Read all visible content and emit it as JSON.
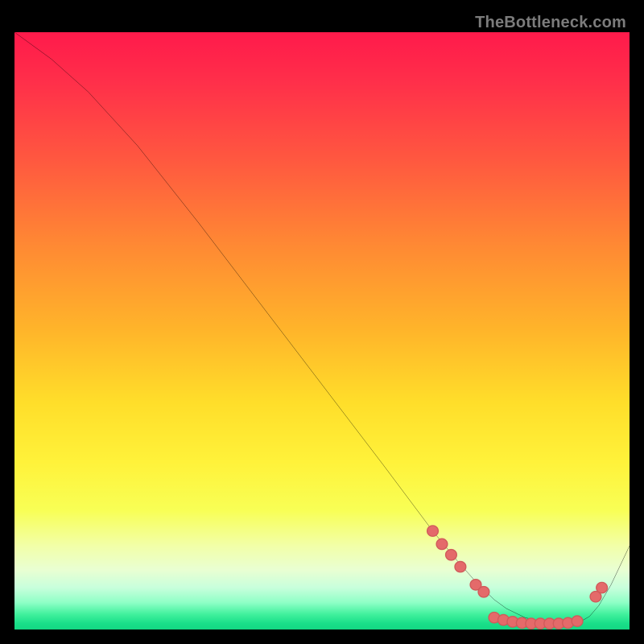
{
  "watermark": "TheBottleneck.com",
  "chart_data": {
    "type": "line",
    "title": "",
    "xlabel": "",
    "ylabel": "",
    "xlim": [
      0,
      100
    ],
    "ylim": [
      0,
      100
    ],
    "series": [
      {
        "name": "curve",
        "x": [
          0,
          6,
          12,
          20,
          30,
          40,
          50,
          60,
          68,
          72,
          75,
          78,
          80,
          83,
          86,
          88,
          90,
          92,
          93.5,
          95,
          97,
          100
        ],
        "y": [
          100,
          95.5,
          90,
          81,
          68,
          54.5,
          41,
          27.5,
          16.5,
          11.5,
          8,
          5,
          3.5,
          2,
          1.2,
          0.8,
          0.8,
          1.3,
          2.2,
          4,
          7.5,
          14
        ]
      }
    ],
    "markers": [
      {
        "x": 68.0,
        "y": 16.5
      },
      {
        "x": 69.5,
        "y": 14.3
      },
      {
        "x": 71.0,
        "y": 12.5
      },
      {
        "x": 72.5,
        "y": 10.5
      },
      {
        "x": 75.0,
        "y": 7.5
      },
      {
        "x": 76.3,
        "y": 6.3
      },
      {
        "x": 78.0,
        "y": 2.0
      },
      {
        "x": 79.5,
        "y": 1.6
      },
      {
        "x": 81.0,
        "y": 1.3
      },
      {
        "x": 82.5,
        "y": 1.1
      },
      {
        "x": 84.0,
        "y": 1.0
      },
      {
        "x": 85.5,
        "y": 1.0
      },
      {
        "x": 87.0,
        "y": 1.0
      },
      {
        "x": 88.5,
        "y": 1.0
      },
      {
        "x": 90.0,
        "y": 1.1
      },
      {
        "x": 91.5,
        "y": 1.4
      },
      {
        "x": 94.5,
        "y": 5.5
      },
      {
        "x": 95.5,
        "y": 7.0
      }
    ],
    "gradient_stops": [
      {
        "pos": 0,
        "color": "#ff1a4b"
      },
      {
        "pos": 8,
        "color": "#ff2e4a"
      },
      {
        "pos": 22,
        "color": "#ff5a3f"
      },
      {
        "pos": 36,
        "color": "#ff8a33"
      },
      {
        "pos": 50,
        "color": "#ffb52a"
      },
      {
        "pos": 62,
        "color": "#ffde2a"
      },
      {
        "pos": 72,
        "color": "#fff23a"
      },
      {
        "pos": 80,
        "color": "#f8ff55"
      },
      {
        "pos": 86,
        "color": "#f2ffa8"
      },
      {
        "pos": 90,
        "color": "#e9ffd2"
      },
      {
        "pos": 93,
        "color": "#c8ffdc"
      },
      {
        "pos": 95.5,
        "color": "#8effc6"
      },
      {
        "pos": 97.5,
        "color": "#3ff09c"
      },
      {
        "pos": 99,
        "color": "#19df89"
      },
      {
        "pos": 100,
        "color": "#14d783"
      }
    ],
    "colors": {
      "curve": "#000000",
      "marker_fill": "#e46a6a",
      "marker_stroke": "#d05a5a",
      "background_border": "#000000"
    }
  }
}
